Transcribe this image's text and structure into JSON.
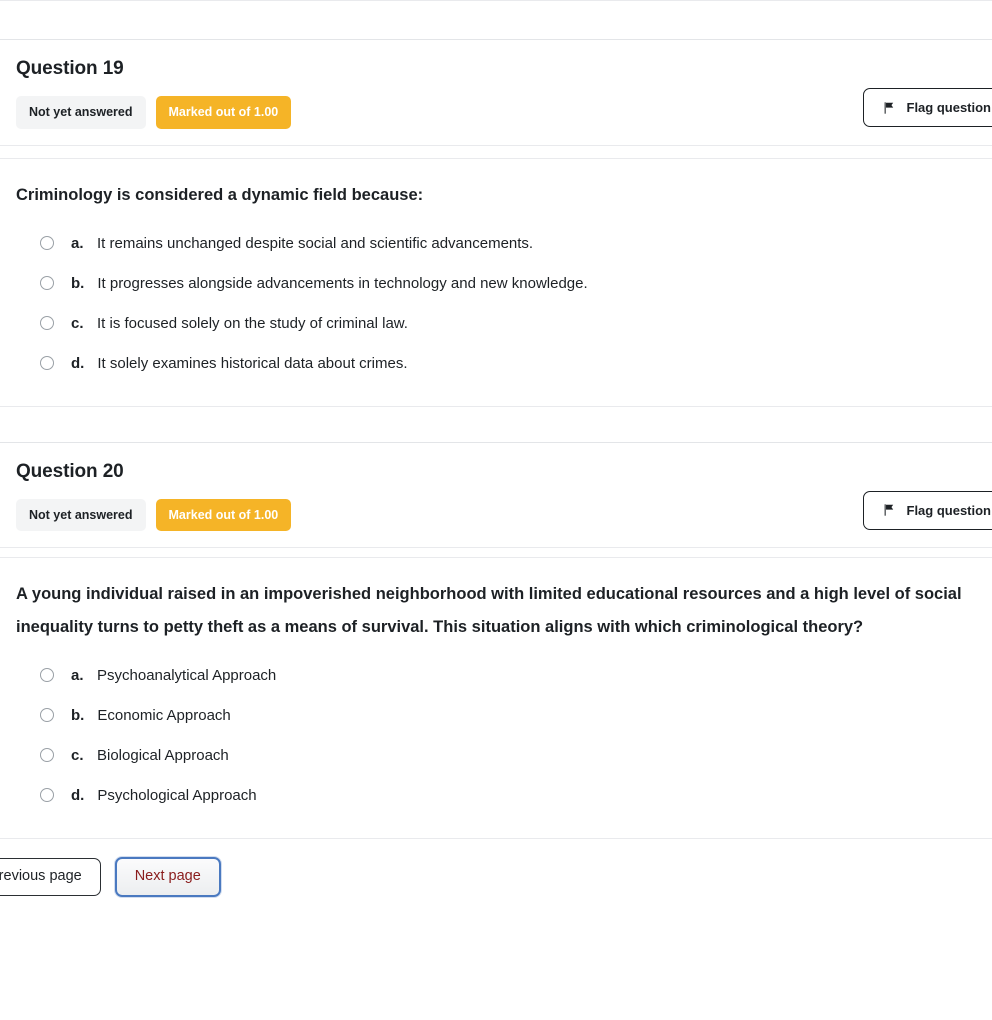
{
  "buttons": {
    "flag_label": "Flag question",
    "flag_icon": "flag-icon"
  },
  "badges": {
    "not_answered": "Not yet answered",
    "marked_out_of": "Marked out of 1.00"
  },
  "colors": {
    "marks_badge_bg": "#f5b427",
    "state_badge_bg": "#f3f4f5",
    "next_page_border": "#4a79c0",
    "next_page_text": "#8a1c1c",
    "divider": "#e9eaed"
  },
  "questions": [
    {
      "title": "Question 19",
      "state": "Not yet answered",
      "marks": "Marked out of 1.00",
      "flag": "Flag question",
      "text": "Criminology is considered a dynamic field because:",
      "answers": [
        {
          "letter": "a.",
          "text": "It remains unchanged despite social and scientific advancements.",
          "selected": false
        },
        {
          "letter": "b.",
          "text": "It progresses alongside advancements in technology and new knowledge.",
          "selected": false
        },
        {
          "letter": "c.",
          "text": "It is focused solely on the study of criminal law.",
          "selected": false
        },
        {
          "letter": "d.",
          "text": "It solely examines historical data about crimes.",
          "selected": false
        }
      ]
    },
    {
      "title": "Question 20",
      "state": "Not yet answered",
      "marks": "Marked out of 1.00",
      "flag": "Flag question",
      "text": "A young individual raised in an impoverished neighborhood with limited educational resources and a high level of social inequality turns to petty theft as a means of survival. This situation aligns with which criminological theory?",
      "answers": [
        {
          "letter": "a.",
          "text": "Psychoanalytical Approach",
          "selected": false
        },
        {
          "letter": "b.",
          "text": "Economic Approach",
          "selected": false
        },
        {
          "letter": "c.",
          "text": "Biological Approach",
          "selected": false
        },
        {
          "letter": "d.",
          "text": "Psychological Approach",
          "selected": false
        }
      ]
    }
  ],
  "navigation": {
    "previous_label": "Previous page",
    "next_label": "Next page"
  }
}
